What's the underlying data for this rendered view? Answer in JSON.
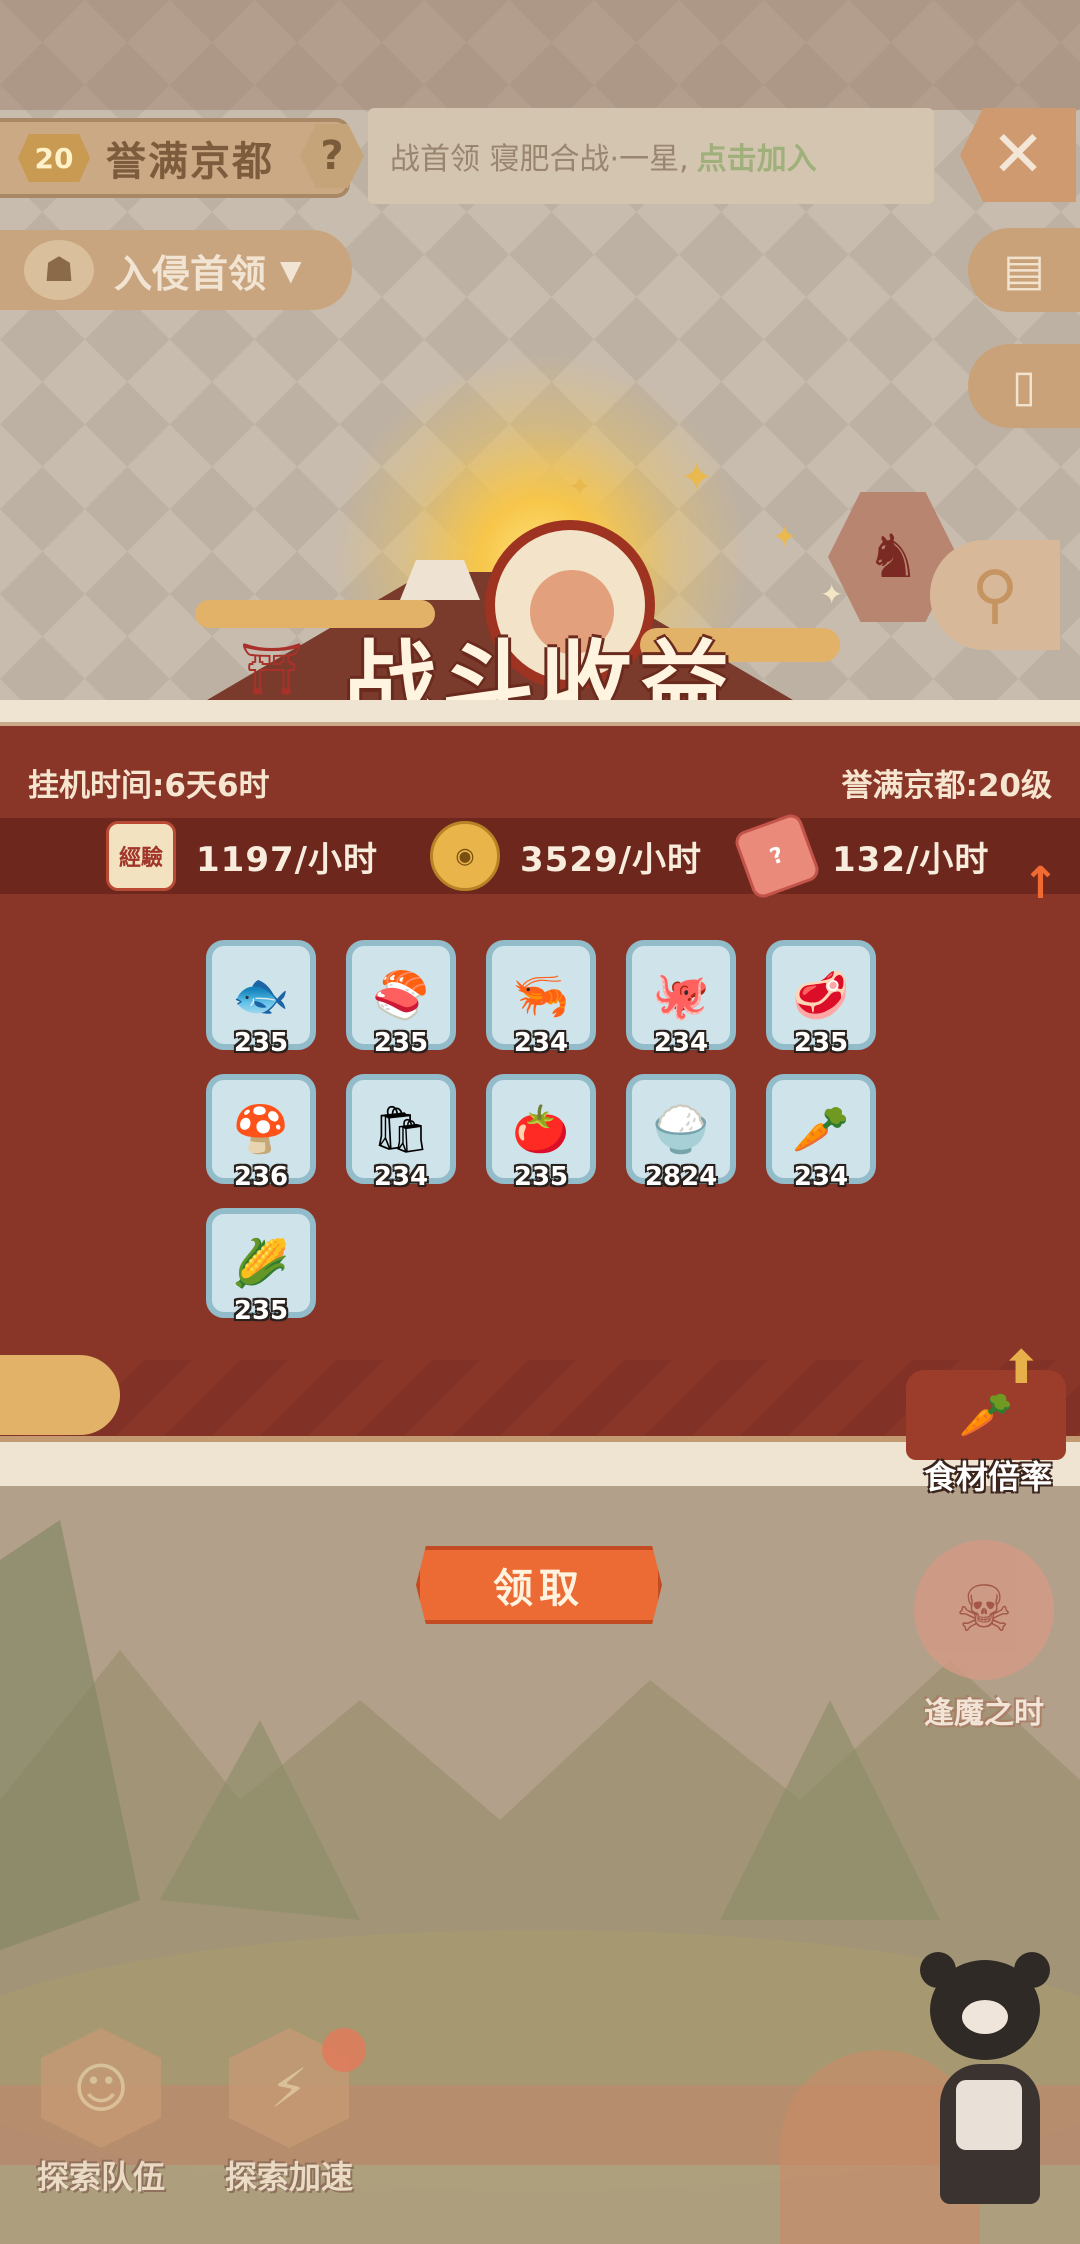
{
  "header": {
    "level": "20",
    "zone_title": "誉满京都",
    "help_icon": "question-icon",
    "notice_text": "战首领 寝肥合战·一星,",
    "notice_link": "点击加入",
    "close_icon": "close-icon",
    "boss_select_label": "入侵首领"
  },
  "side_buttons": [
    "notebook-icon",
    "card-icon"
  ],
  "banner": {
    "title": "战斗收益"
  },
  "stats": {
    "idle_time": "挂机时间:6天6时",
    "zone_level": "誉满京都:20级"
  },
  "rates": [
    {
      "icon": "exp-scroll-icon",
      "icon_text": "經驗",
      "value": "1197/小时"
    },
    {
      "icon": "coin-icon",
      "icon_text": "◉",
      "value": "3529/小时"
    },
    {
      "icon": "meat-ticket-icon",
      "icon_text": "?",
      "value": "132/小时"
    }
  ],
  "items": [
    {
      "name": "catfish",
      "glyph": "🐟",
      "count": "235"
    },
    {
      "name": "salmon",
      "glyph": "🍣",
      "count": "235"
    },
    {
      "name": "shrimp",
      "glyph": "🦐",
      "count": "234"
    },
    {
      "name": "octopus",
      "glyph": "🐙",
      "count": "234"
    },
    {
      "name": "meat",
      "glyph": "🥩",
      "count": "235"
    },
    {
      "name": "mushroom",
      "glyph": "🍄",
      "count": "236"
    },
    {
      "name": "flour-sack",
      "glyph": "🛍",
      "count": "234"
    },
    {
      "name": "tomato",
      "glyph": "🍅",
      "count": "235"
    },
    {
      "name": "rice-bowl",
      "glyph": "🍚",
      "count": "2824"
    },
    {
      "name": "radish",
      "glyph": "🥕",
      "count": "234"
    },
    {
      "name": "corn",
      "glyph": "🌽",
      "count": "235"
    }
  ],
  "multiplier_label": "食材倍率",
  "claim_label": "领取",
  "demon_time_label": "逢魔之时",
  "bottom_buttons": [
    {
      "label": "探索队伍",
      "icon": "team-icon"
    },
    {
      "label": "探索加速",
      "icon": "speed-icon"
    }
  ],
  "colors": {
    "panel": "#893629",
    "accent_orange": "#ec6a33",
    "tile_bg": "#cfe3ea"
  }
}
